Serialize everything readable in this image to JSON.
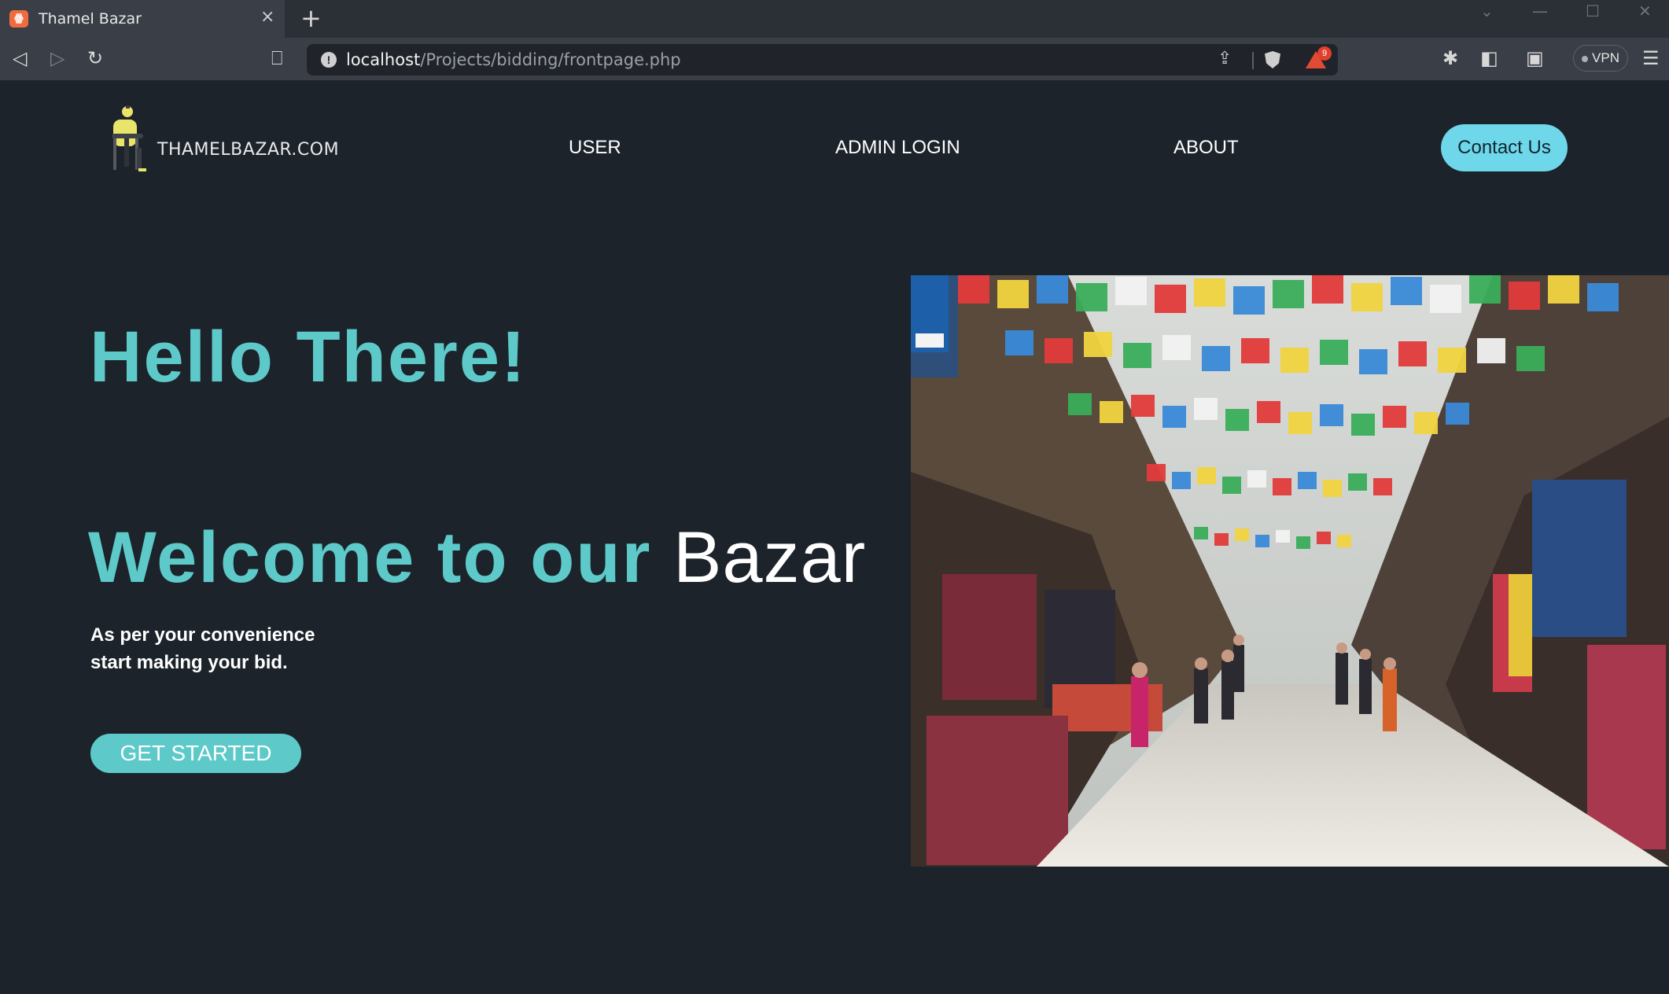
{
  "browser": {
    "tab_title": "Thamel Bazar",
    "tab_close": "×",
    "new_tab": "+",
    "url_host": "localhost",
    "url_path": "/Projects/bidding/frontpage.php",
    "rewards_badge": "9",
    "vpn_label": "VPN"
  },
  "site": {
    "logo_text": "THAMELBAZAR.COM",
    "nav": {
      "user": "USER",
      "admin_login": "ADMIN LOGIN",
      "about": "ABOUT",
      "contact": "Contact Us"
    },
    "hero": {
      "hello": "Hello There!",
      "welcome_bold": "Welcome to our",
      "welcome_light": "Bazar",
      "sub_line1": "As per your convenience",
      "sub_line2": "start making your bid.",
      "cta": "GET STARTED"
    }
  },
  "colors": {
    "page_bg": "#1c232b",
    "accent_teal": "#5dc9c9",
    "contact_bg": "#6fd7ea"
  }
}
